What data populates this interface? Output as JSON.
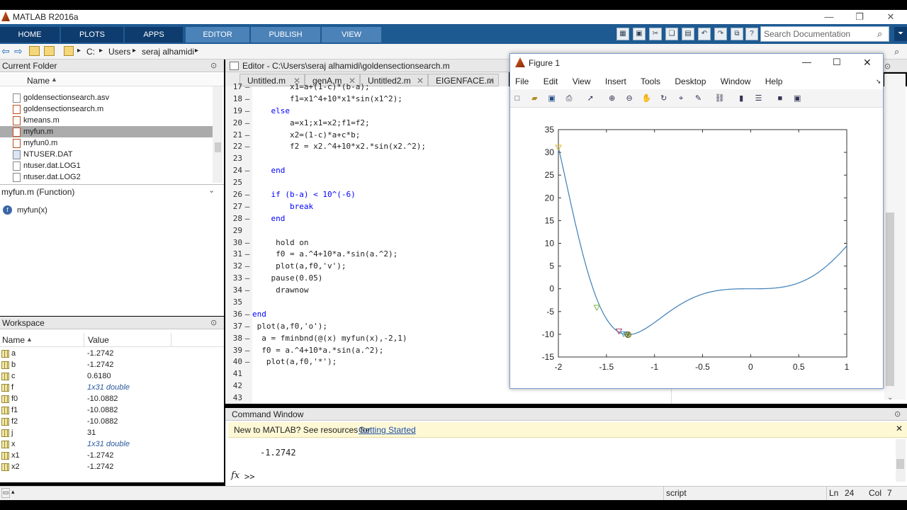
{
  "app_title": "MATLAB R2016a",
  "ribbon_tabs": [
    "HOME",
    "PLOTS",
    "APPS",
    "EDITOR",
    "PUBLISH",
    "VIEW"
  ],
  "search_placeholder": "Search Documentation",
  "address": {
    "drive": "C:",
    "crumbs": [
      "Users",
      "seraj alhamidi"
    ]
  },
  "current_folder": {
    "title": "Current Folder",
    "column": "Name",
    "files": [
      "goldensectionsearch.asv",
      "goldensectionsearch.m",
      "kmeans.m",
      "myfun.m",
      "myfun0.m",
      "NTUSER.DAT",
      "ntuser.dat.LOG1",
      "ntuser.dat.LOG2"
    ],
    "selected": "myfun.m"
  },
  "details": {
    "title": "myfun.m  (Function)",
    "item": "myfun(x)"
  },
  "workspace": {
    "title": "Workspace",
    "col_name": "Name",
    "col_value": "Value",
    "vars": [
      {
        "name": "a",
        "value": "-1.2742"
      },
      {
        "name": "b",
        "value": "-1.2742"
      },
      {
        "name": "c",
        "value": "0.6180"
      },
      {
        "name": "f",
        "value": "1x31 double"
      },
      {
        "name": "f0",
        "value": "-10.0882"
      },
      {
        "name": "f1",
        "value": "-10.0882"
      },
      {
        "name": "f2",
        "value": "-10.0882"
      },
      {
        "name": "j",
        "value": "31"
      },
      {
        "name": "x",
        "value": "1x31 double"
      },
      {
        "name": "x1",
        "value": "-1.2742"
      },
      {
        "name": "x2",
        "value": "-1.2742"
      }
    ]
  },
  "editor": {
    "title": "Editor - C:\\Users\\seraj alhamidi\\goldensectionsearch.m",
    "tabs": [
      "Untitled.m",
      "genA.m",
      "Untitled2.m",
      "EIGENFACE.m"
    ],
    "lines": [
      {
        "n": "17",
        "t": "        x1=a+(1-c)*(b-a);"
      },
      {
        "n": "18",
        "t": "        f1=x1^4+10*x1*sin(x1^2);"
      },
      {
        "n": "19",
        "t": "    else"
      },
      {
        "n": "20",
        "t": "        a=x1;x1=x2;f1=f2;"
      },
      {
        "n": "21",
        "t": "        x2=(1-c)*a+c*b;"
      },
      {
        "n": "22",
        "t": "        f2 = x2.^4+10*x2.*sin(x2.^2);"
      },
      {
        "n": "23",
        "t": ""
      },
      {
        "n": "24",
        "t": "    end"
      },
      {
        "n": "25",
        "t": ""
      },
      {
        "n": "26",
        "t": "    if (b-a) < 10^(-6)"
      },
      {
        "n": "27",
        "t": "        break"
      },
      {
        "n": "28",
        "t": "    end"
      },
      {
        "n": "29",
        "t": ""
      },
      {
        "n": "30",
        "t": "     hold on"
      },
      {
        "n": "31",
        "t": "     f0 = a.^4+10*a.*sin(a.^2);"
      },
      {
        "n": "32",
        "t": "     plot(a,f0,'v');"
      },
      {
        "n": "33",
        "t": "    pause(0.05)"
      },
      {
        "n": "34",
        "t": "     drawnow"
      },
      {
        "n": "35",
        "t": ""
      },
      {
        "n": "36",
        "t": "end"
      },
      {
        "n": "37",
        "t": " plot(a,f0,'o');"
      },
      {
        "n": "38",
        "t": "  a = fminbnd(@(x) myfun(x),-2,1)"
      },
      {
        "n": "39",
        "t": "  f0 = a.^4+10*a.*sin(a.^2);"
      },
      {
        "n": "40",
        "t": "   plot(a,f0,'*');"
      },
      {
        "n": "41",
        "t": ""
      },
      {
        "n": "42",
        "t": ""
      },
      {
        "n": "43",
        "t": ""
      }
    ]
  },
  "figure": {
    "title": "Figure 1",
    "menu": [
      "File",
      "Edit",
      "View",
      "Insert",
      "Tools",
      "Desktop",
      "Window",
      "Help"
    ]
  },
  "chart_data": {
    "type": "line",
    "title": "",
    "xlim": [
      -2,
      1
    ],
    "ylim": [
      -15,
      35
    ],
    "xticks": [
      -2,
      -1.5,
      -1,
      -0.5,
      0,
      0.5,
      1
    ],
    "yticks": [
      -15,
      -10,
      -5,
      0,
      5,
      10,
      15,
      20,
      25,
      30,
      35
    ],
    "series": [
      {
        "function": "x^4+10*x*sin(x^2)",
        "color": "#3d7fb8"
      }
    ],
    "markers": [
      {
        "x": -2.0,
        "y": 31.1,
        "symbol": "v",
        "color": "#e8b52c"
      },
      {
        "x": -1.6,
        "y": -4.1,
        "symbol": "v",
        "color": "#7ab548"
      },
      {
        "x": -1.37,
        "y": -9.3,
        "symbol": "v",
        "color": "#b2456e"
      },
      {
        "x": -1.32,
        "y": -9.9,
        "symbol": "v",
        "color": "#4ea7c8"
      },
      {
        "x": -1.29,
        "y": -10.05,
        "symbol": "v",
        "color": "#3d7fb8"
      },
      {
        "x": -1.2742,
        "y": -10.0882,
        "symbol": "o",
        "color": "#8a6d20"
      },
      {
        "x": -1.2742,
        "y": -10.0882,
        "symbol": "*",
        "color": "#6a7f20"
      }
    ]
  },
  "command_window": {
    "title": "Command Window",
    "banner": "New to MATLAB? See resources for",
    "banner_link": "Getting Started",
    "output": "-1.2742",
    "prompt": ">>"
  },
  "status": {
    "mode": "script",
    "ln_label": "Ln",
    "ln": "24",
    "col_label": "Col",
    "col": "7"
  }
}
